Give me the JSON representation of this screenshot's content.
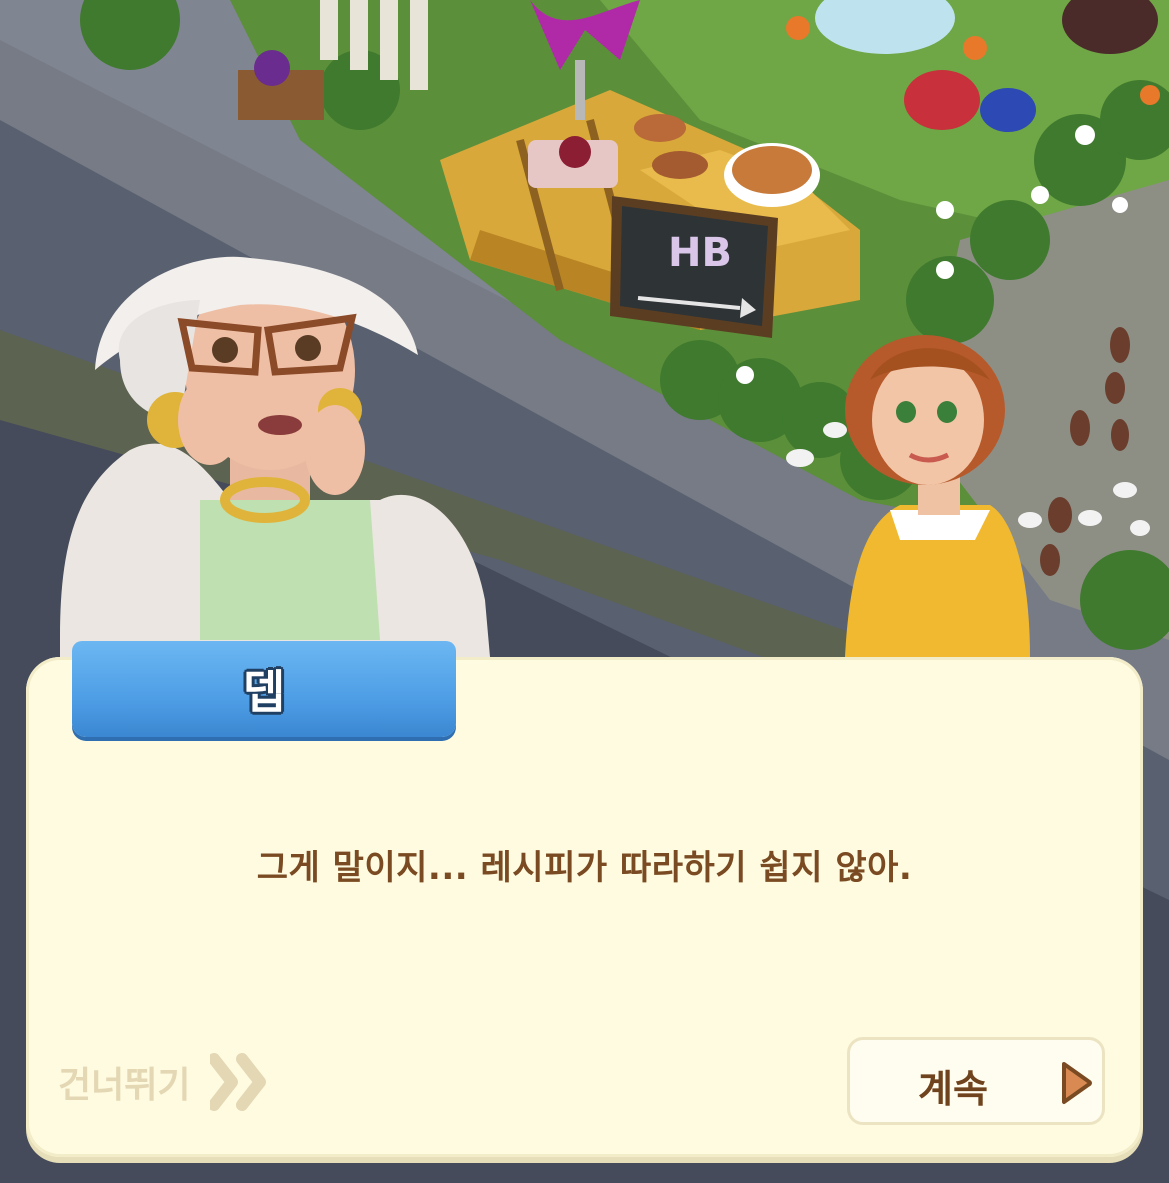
{
  "dialog": {
    "speaker_name": "뎁",
    "message": "그게 말이지... 레시피가 따라하기 쉽지 않아."
  },
  "controls": {
    "skip_label": "건너뛰기",
    "skip_icon": "double-chevron-right-icon",
    "continue_label": "계속",
    "continue_icon": "play-arrow-icon"
  },
  "scene": {
    "sign_text": "HB",
    "characters": [
      "deb-elderly-woman-white-hat",
      "young-woman-red-hair-yellow-top"
    ]
  },
  "colors": {
    "name_tag": "#4e9ee6",
    "dialog_bg": "#fffbe0",
    "text_brown": "#7a4b22",
    "skip_text": "#e3d7b4",
    "arrow_orange": "#d98a52"
  }
}
